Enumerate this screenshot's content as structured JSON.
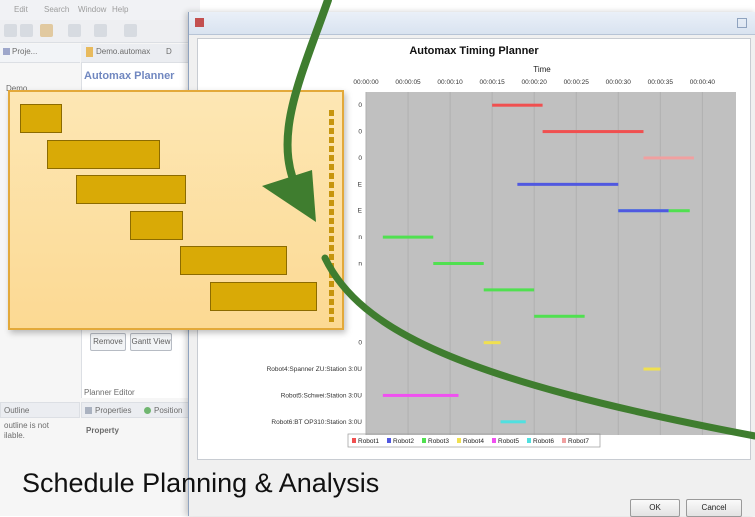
{
  "ide": {
    "menu": [
      "Edit",
      "Search",
      "Window",
      "Help"
    ],
    "project_tab": "Proje...",
    "editor_tabs": [
      "Demo.automax",
      "D"
    ],
    "tree_item": "Demo",
    "planner_title": "Automax Planner",
    "buttons": {
      "remove": "Remove",
      "gantt": "Gantt View"
    },
    "planner_editor": "Planner Editor",
    "outline_tab": "Outline",
    "outline_msg_1": "outline is not",
    "outline_msg_2": "ilable.",
    "properties_tab": "Properties",
    "position_tab": "Position",
    "property_header": "Property"
  },
  "dialog": {
    "ok": "OK",
    "cancel": "Cancel"
  },
  "chart_data": {
    "type": "gantt",
    "title": "Automax Timing Planner",
    "xlabel": "Time",
    "x_ticks": [
      "00:00:00",
      "00:00:05",
      "00:00:10",
      "00:00:15",
      "00:00:20",
      "00:00:25",
      "00:00:30",
      "00:00:35",
      "00:00:40"
    ],
    "x_range_seconds": [
      0,
      44
    ],
    "row_labels": [
      "",
      "",
      "",
      "",
      "",
      "",
      "",
      "",
      "",
      "",
      "Robot4:Spanner ZU:Station 3:0U",
      "Robot5:Schwei:Station 3:0U",
      "Robot6:BT OP310:Station 3:0U"
    ],
    "row_label_fragments": [
      "0",
      "0",
      "0",
      "E",
      "E",
      "n",
      "n",
      "",
      "",
      "0",
      "",
      "",
      ""
    ],
    "series": [
      {
        "name": "Robot1",
        "color": "#f05050"
      },
      {
        "name": "Robot2",
        "color": "#5058e0"
      },
      {
        "name": "Robot3",
        "color": "#50e050"
      },
      {
        "name": "Robot4",
        "color": "#f0e050"
      },
      {
        "name": "Robot5",
        "color": "#f050f0"
      },
      {
        "name": "Robot6",
        "color": "#50e0e0"
      },
      {
        "name": "Robot7",
        "color": "#f0a0a0"
      }
    ],
    "tasks": [
      {
        "row": 0,
        "start": 15.0,
        "end": 21.0,
        "series": 0
      },
      {
        "row": 1,
        "start": 21.0,
        "end": 33.0,
        "series": 0
      },
      {
        "row": 2,
        "start": 33.0,
        "end": 39.0,
        "series": 6
      },
      {
        "row": 3,
        "start": 18.0,
        "end": 30.0,
        "series": 1
      },
      {
        "row": 4,
        "start": 30.0,
        "end": 36.0,
        "series": 5
      },
      {
        "row": 4,
        "start": 30.0,
        "end": 36.0,
        "series": 1
      },
      {
        "row": 4,
        "start": 36.0,
        "end": 38.5,
        "series": 2
      },
      {
        "row": 5,
        "start": 2.0,
        "end": 8.0,
        "series": 2
      },
      {
        "row": 6,
        "start": 8.0,
        "end": 14.0,
        "series": 2
      },
      {
        "row": 7,
        "start": 14.0,
        "end": 20.0,
        "series": 2
      },
      {
        "row": 8,
        "start": 20.0,
        "end": 26.0,
        "series": 2
      },
      {
        "row": 9,
        "start": 14.0,
        "end": 16.0,
        "series": 3
      },
      {
        "row": 10,
        "start": 33.0,
        "end": 35.0,
        "series": 3
      },
      {
        "row": 11,
        "start": 2.0,
        "end": 11.0,
        "series": 4
      },
      {
        "row": 12,
        "start": 16.0,
        "end": 19.0,
        "series": 5
      }
    ]
  },
  "callout": {
    "bars": [
      {
        "start": 0.0,
        "end": 0.14
      },
      {
        "start": 0.09,
        "end": 0.47
      },
      {
        "start": 0.19,
        "end": 0.56
      },
      {
        "start": 0.37,
        "end": 0.55
      },
      {
        "start": 0.54,
        "end": 0.9
      },
      {
        "start": 0.64,
        "end": 1.0
      }
    ]
  },
  "caption": "Schedule Planning & Analysis",
  "colors": {
    "arrow": "#3f7d2f",
    "callout_border": "#e3a93a",
    "callout_fill": "#fcd993",
    "callout_bar": "#d9aa06",
    "plot_bg": "#c0c0c0"
  }
}
